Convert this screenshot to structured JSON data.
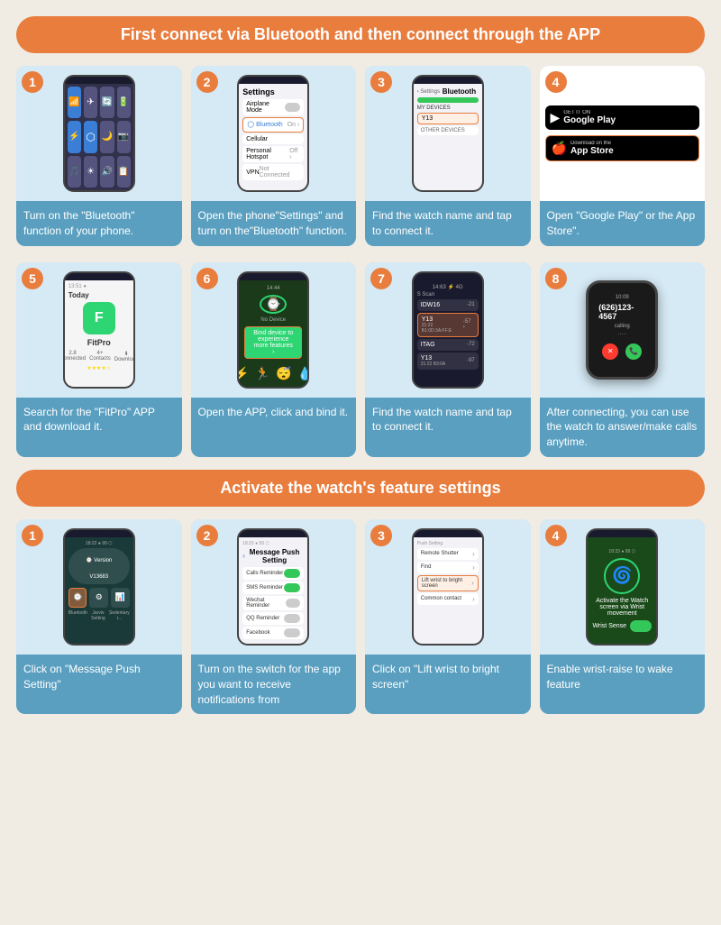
{
  "section1": {
    "banner": "First connect via Bluetooth and then connect through the APP",
    "steps": [
      {
        "number": "1",
        "desc": "Turn on the \"Bluetooth\" function of your phone."
      },
      {
        "number": "2",
        "desc": "Open the phone\"Settings\" and turn on the\"Bluetooth\" function."
      },
      {
        "number": "3",
        "desc": "Find the watch name and tap to connect it."
      },
      {
        "number": "4",
        "desc": "Open \"Google Play\" or the App Store\"."
      },
      {
        "number": "5",
        "desc": "Search for the \"FitPro\" APP and download it."
      },
      {
        "number": "6",
        "desc": "Open the APP, click and bind it."
      },
      {
        "number": "7",
        "desc": "Find the watch name and tap to connect it."
      },
      {
        "number": "8",
        "desc": "After connecting, you can use the watch to answer/make calls anytime."
      }
    ]
  },
  "section2": {
    "banner": "Activate the watch's feature settings",
    "steps": [
      {
        "number": "1",
        "desc": "Click on \"Message Push Setting\""
      },
      {
        "number": "2",
        "desc": "Turn on the switch for the app you want to receive notifications from"
      },
      {
        "number": "3",
        "desc": "Click on \"Lift wrist to bright screen\""
      },
      {
        "number": "4",
        "desc": "Enable wrist-raise to wake feature"
      }
    ]
  },
  "appStore": {
    "googlePlay": "Google Play",
    "getItOn": "GET IT ON",
    "downloadOn": "Download on the",
    "appStore": "App Store"
  },
  "fitpro": {
    "name": "FitPro",
    "watchName": "Y13"
  }
}
